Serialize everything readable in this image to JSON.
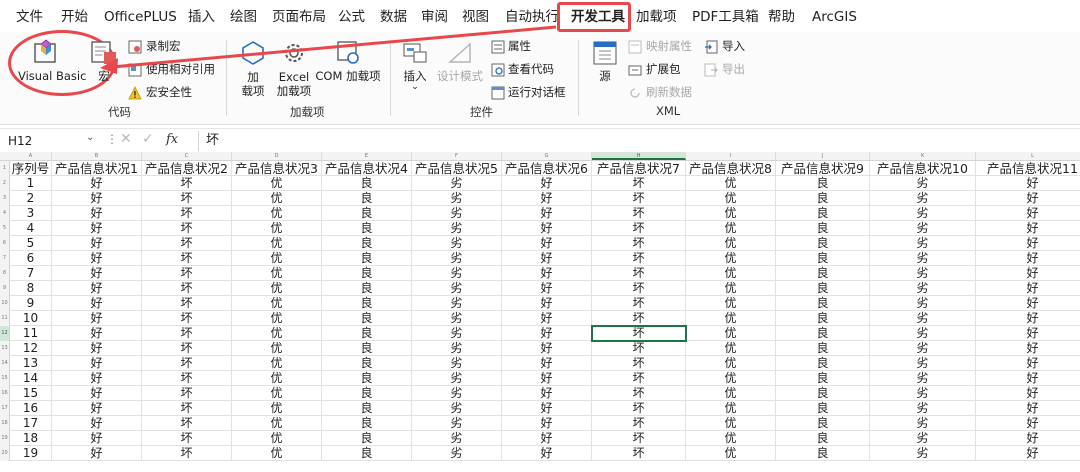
{
  "menu": {
    "items": [
      "文件",
      "开始",
      "OfficePLUS",
      "插入",
      "绘图",
      "页面布局",
      "公式",
      "数据",
      "审阅",
      "视图",
      "自动执行",
      "开发工具",
      "加载项",
      "PDF工具箱",
      "帮助",
      "ArcGIS"
    ],
    "active_index": 11
  },
  "ribbon": {
    "code_group": {
      "label": "代码",
      "visual_basic": "Visual Basic",
      "macros": "宏",
      "record_macro": "录制宏",
      "relative_refs": "使用相对引用",
      "macro_security": "宏安全性"
    },
    "addins_group": {
      "label": "加载项",
      "addins": "加\n载项",
      "addins_line1": "加",
      "addins_line2": "载项",
      "excel_addins_line1": "Excel",
      "excel_addins_line2": "加载项",
      "com_addins": "COM 加载项"
    },
    "controls_group": {
      "label": "控件",
      "insert": "插入",
      "design_mode": "设计模式",
      "properties": "属性",
      "view_code": "查看代码",
      "run_dialog": "运行对话框"
    },
    "xml_group": {
      "label": "XML",
      "source": "源",
      "map_properties": "映射属性",
      "expansion_packs": "扩展包",
      "refresh_data": "刷新数据",
      "import": "导入",
      "export": "导出"
    }
  },
  "formula_bar": {
    "name_box": "H12",
    "fx": "fx",
    "value": "坏"
  },
  "sheet": {
    "columns": [
      "A",
      "B",
      "C",
      "D",
      "E",
      "F",
      "G",
      "H",
      "I",
      "J",
      "K",
      "L"
    ],
    "selected_column": "H",
    "selected_row": 12,
    "header_row": [
      "序列号",
      "产品信息状况1",
      "产品信息状况2",
      "产品信息状况3",
      "产品信息状况4",
      "产品信息状况5",
      "产品信息状况6",
      "产品信息状况7",
      "产品信息状况8",
      "产品信息状况9",
      "产品信息状况10",
      "产品信息状况11"
    ],
    "row_pattern": [
      "好",
      "坏",
      "优",
      "良",
      "劣",
      "好",
      "坏",
      "优",
      "良",
      "劣",
      "好"
    ],
    "row_count": 19
  },
  "colors": {
    "accent_green": "#217346",
    "annotation_red": "#e8474b"
  }
}
